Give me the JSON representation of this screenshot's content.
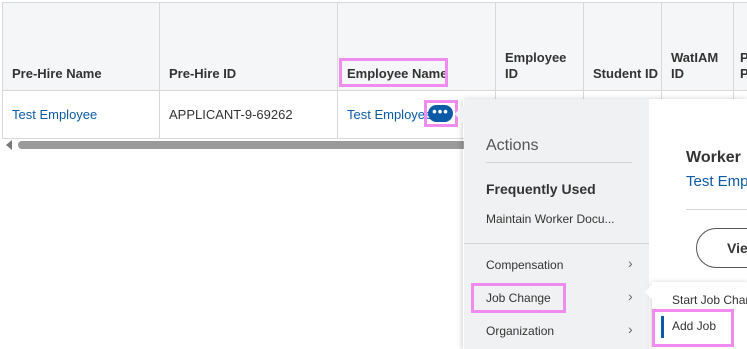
{
  "table": {
    "headers": [
      "Pre-Hire Name",
      "Pre-Hire ID",
      "Employee Name",
      "Employee ID",
      "Student ID",
      "WatIAM ID",
      "P P"
    ],
    "row": {
      "pre_hire_name": "Test Employee",
      "pre_hire_id": "APPLICANT-9-69262",
      "employee_name": "Test Employee"
    }
  },
  "actions_button": {
    "label": "•••"
  },
  "actions_menu": {
    "title": "Actions",
    "frequently_used_heading": "Frequently Used",
    "frequently_used_item": "Maintain Worker Docu...",
    "items": [
      {
        "label": "Compensation"
      },
      {
        "label": "Job Change"
      },
      {
        "label": "Organization"
      }
    ],
    "chevron_glyph": "›"
  },
  "worker_card": {
    "title": "Worker",
    "name": "Test Emp",
    "view_button": "Vie"
  },
  "submenu": {
    "items": [
      "Start Job Char",
      "Add Job"
    ]
  },
  "colors": {
    "link": "#0b5aa7",
    "highlight": "#f08cf0",
    "header_bg": "#f5f6f7"
  }
}
